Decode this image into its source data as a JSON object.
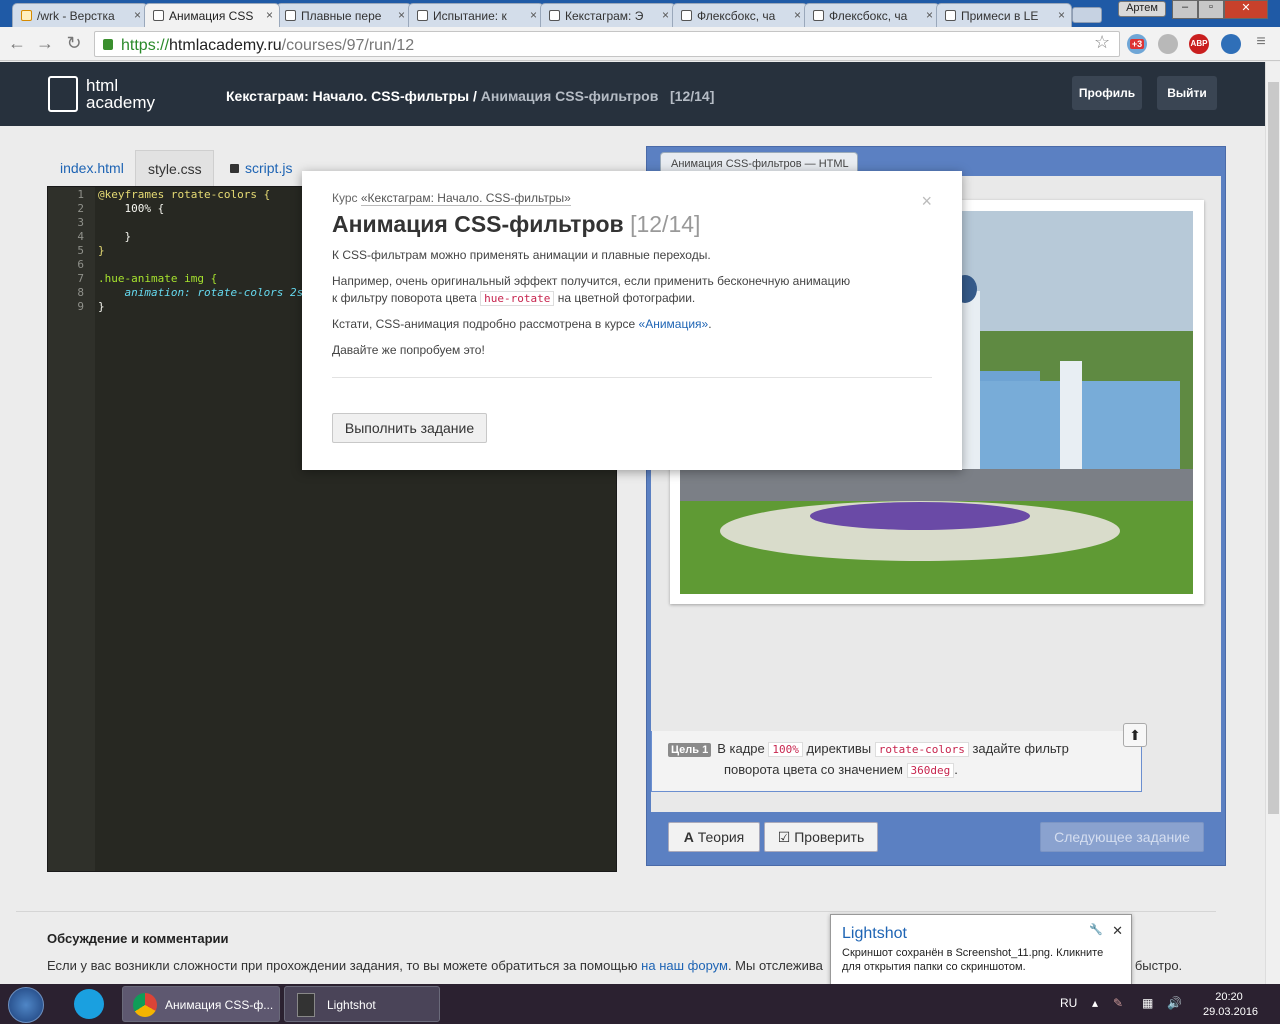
{
  "browser": {
    "tabs": [
      {
        "label": "/wrk - Верстка"
      },
      {
        "label": "Анимация CSS"
      },
      {
        "label": "Плавные пере"
      },
      {
        "label": "Испытание: к"
      },
      {
        "label": "Кекстаграм: Э"
      },
      {
        "label": "Флексбокс, ча"
      },
      {
        "label": "Флексбокс, ча"
      },
      {
        "label": "Примеси в LE"
      }
    ],
    "user": "Артем",
    "url_scheme": "https://",
    "url_host": "htmlacademy.ru",
    "url_path": "/courses/97/run/12",
    "ext_badge": "+3",
    "abp": "ABP"
  },
  "site": {
    "logo_line1": "html",
    "logo_line2": "academy",
    "breadcrumb_course": "Кекстаграм: Начало. CSS-фильтры /",
    "breadcrumb_current": "Анимация CSS-фильтров",
    "breadcrumb_progress": "[12/14]",
    "profile": "Профиль",
    "logout": "Выйти"
  },
  "editor": {
    "tabs": [
      "index.html",
      "style.css",
      "script.js"
    ],
    "lines": [
      {
        "n": "1",
        "text": "@keyframes rotate-colors {"
      },
      {
        "n": "2",
        "text": "    100% {"
      },
      {
        "n": "3",
        "text": ""
      },
      {
        "n": "4",
        "text": "    }"
      },
      {
        "n": "5",
        "text": "}"
      },
      {
        "n": "6",
        "text": ""
      },
      {
        "n": "7",
        "text": ".hue-animate img {"
      },
      {
        "n": "8",
        "text": "    animation: rotate-colors 2s"
      },
      {
        "n": "9",
        "text": "}"
      }
    ]
  },
  "preview": {
    "tab": "Анимация CSS-фильтров — HTML",
    "goal_tag": "Цель 1",
    "goal_t1": "В кадре",
    "goal_c1": "100%",
    "goal_t2": "директивы",
    "goal_c2": "rotate-colors",
    "goal_t3": "задайте фильтр",
    "goal_t4": "поворота цвета со значением",
    "goal_c3": "360deg",
    "goal_t5": ".",
    "theory": "Теория",
    "check": "Проверить",
    "next": "Следующее задание"
  },
  "modal": {
    "course_prefix": "Курс",
    "course_link": "«Кекстаграм: Начало. CSS-фильтры»",
    "title": "Анимация CSS-фильтров",
    "progress": "[12/14]",
    "p1": "К CSS-фильтрам можно применять анимации и плавные переходы.",
    "p2a": "Например, очень оригинальный эффект получится, если применить бесконечную анимацию",
    "p2b": "к фильтру поворота цвета",
    "p2code": "hue-rotate",
    "p2c": "на цветной фотографии.",
    "p3a": "Кстати, CSS-анимация подробно рассмотрена в курсе",
    "p3link": "«Анимация»",
    "p3b": ".",
    "p4": "Давайте же попробуем это!",
    "button": "Выполнить задание",
    "close": "×"
  },
  "discussion": {
    "title": "Обсуждение и комментарии",
    "text_a": "Если у вас возникли сложности при прохождении задания, то вы можете обратиться за помощью",
    "link": "на наш форум",
    "text_b": ". Мы отслежива",
    "tail": "о быстро."
  },
  "lightshot": {
    "title": "Lightshot",
    "body1": "Скриншот сохранён в Screenshot_11.png. Кликните",
    "body2": "для открытия папки со скриншотом."
  },
  "taskbar": {
    "items": [
      {
        "label": "Анимация CSS-ф..."
      },
      {
        "label": "Lightshot"
      }
    ],
    "lang": "RU",
    "time": "20:20",
    "date": "29.03.2016"
  }
}
